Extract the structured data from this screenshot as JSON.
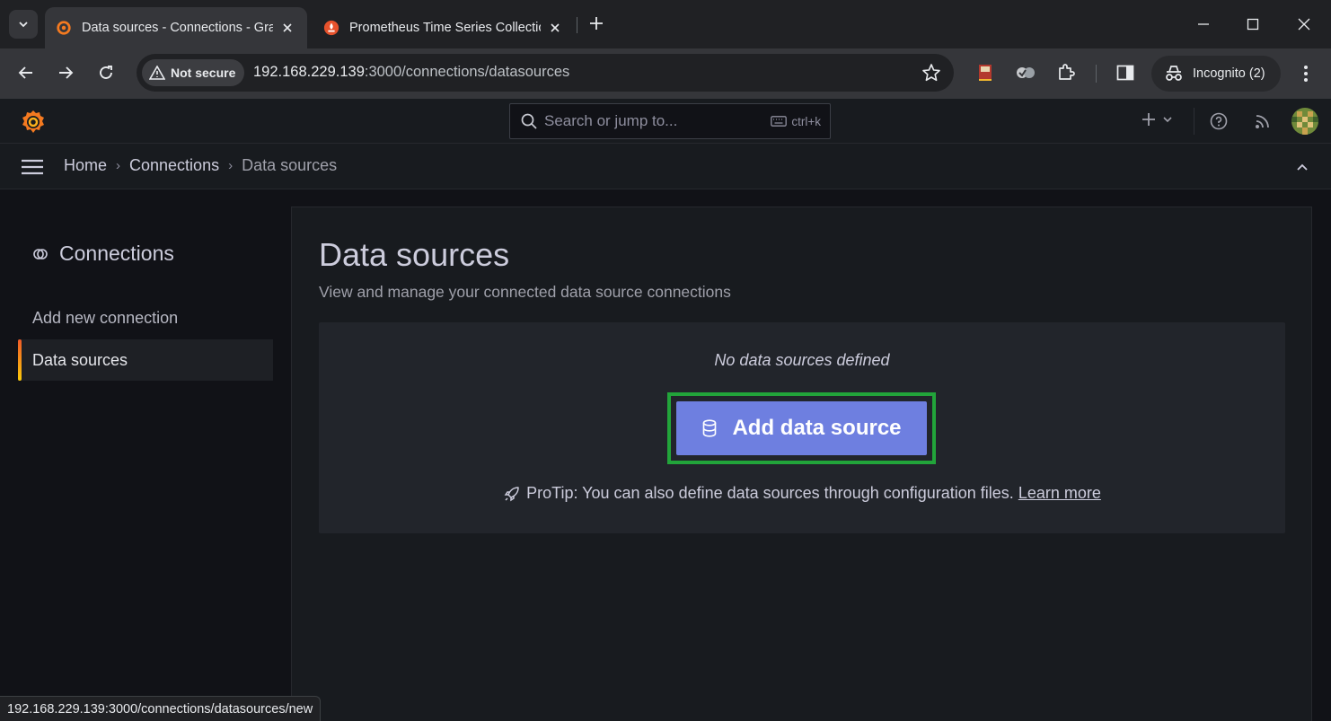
{
  "browser": {
    "tabs": [
      {
        "title": "Data sources - Connections - Grafana",
        "active": true
      },
      {
        "title": "Prometheus Time Series Collection",
        "active": false
      }
    ],
    "security_label": "Not secure",
    "url_host": "192.168.229.139",
    "url_rest": ":3000/connections/datasources",
    "incognito_label": "Incognito (2)",
    "status_url": "192.168.229.139:3000/connections/datasources/new"
  },
  "grafana": {
    "search_placeholder": "Search or jump to...",
    "search_shortcut": "ctrl+k",
    "breadcrumb": [
      "Home",
      "Connections",
      "Data sources"
    ]
  },
  "sidebar": {
    "heading": "Connections",
    "items": [
      {
        "label": "Add new connection",
        "active": false
      },
      {
        "label": "Data sources",
        "active": true
      }
    ]
  },
  "main": {
    "title": "Data sources",
    "subtitle": "View and manage your connected data source connections",
    "empty_message": "No data sources defined",
    "add_button_label": "Add data source",
    "protip_text": "ProTip: You can also define data sources through configuration files.",
    "protip_link": "Learn more"
  },
  "colors": {
    "accent": "#6e7fe0",
    "highlight": "#22a43a",
    "active_bar": "#f05a28"
  }
}
